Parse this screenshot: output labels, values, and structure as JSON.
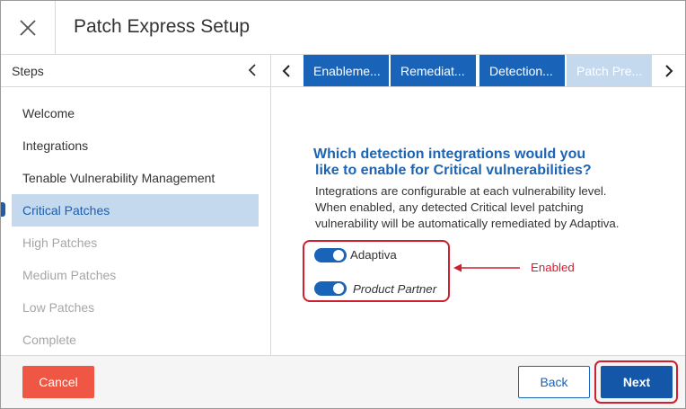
{
  "window": {
    "title": "Patch Express Setup",
    "close_icon": "close-icon"
  },
  "sidebar": {
    "header": "Steps",
    "collapse_icon": "chevron-left-icon",
    "items": [
      {
        "label": "Welcome",
        "state": "complete"
      },
      {
        "label": "Integrations",
        "state": "complete"
      },
      {
        "label": "Tenable Vulnerability Management",
        "state": "complete"
      },
      {
        "label": "Critical Patches",
        "state": "active"
      },
      {
        "label": "High Patches",
        "state": "disabled"
      },
      {
        "label": "Medium Patches",
        "state": "disabled"
      },
      {
        "label": "Low Patches",
        "state": "disabled"
      },
      {
        "label": "Complete",
        "state": "disabled"
      }
    ]
  },
  "tabs": {
    "prev_icon": "chevron-left-icon",
    "next_icon": "chevron-right-icon",
    "items": [
      {
        "label": "Enableme..."
      },
      {
        "label": "Remediat..."
      },
      {
        "label": "Detection..."
      },
      {
        "label": "Patch Pre..."
      }
    ]
  },
  "content": {
    "question_line1": "Which detection integrations would you",
    "question_line2": "like to enable for Critical vulnerabilities?",
    "desc_line1": "Integrations are configurable at each vulnerability level.",
    "desc_line2": "When enabled, any detected Critical level patching",
    "desc_line3": "vulnerability will be automatically remediated by Adaptiva.",
    "integrations": [
      {
        "label": "Adaptiva",
        "enabled": true
      },
      {
        "label": "Product Partner",
        "enabled": true
      }
    ],
    "annotation": "Enabled"
  },
  "footer": {
    "cancel_label": "Cancel",
    "back_label": "Back",
    "next_label": "Next"
  },
  "colors": {
    "accent": "#1963b8",
    "tab_inactive": "#c4d8ee",
    "cancel": "#ef5643",
    "annotation_red": "#d01f2e"
  }
}
